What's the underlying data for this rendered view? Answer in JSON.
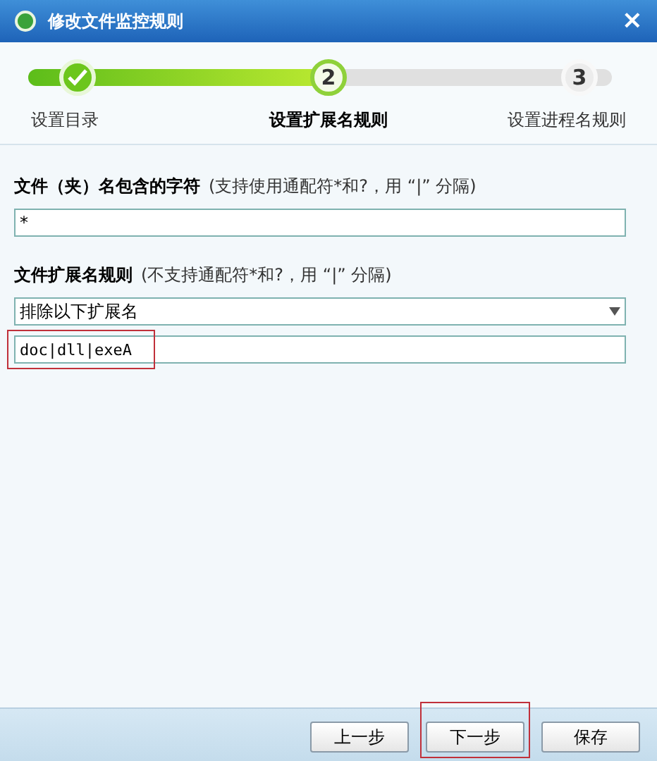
{
  "window": {
    "title": "修改文件监控规则",
    "close": "×"
  },
  "progress": {
    "level": 0.5
  },
  "steps": [
    {
      "label": "设置目录",
      "kind": "done"
    },
    {
      "number": "2",
      "label": "设置扩展名规则",
      "kind": "current"
    },
    {
      "number": "3",
      "label": "设置进程名规则",
      "kind": "pending"
    }
  ],
  "name_filter": {
    "label": "文件（夹）名包含的字符",
    "hint": "(支持使用通配符*和?，用 “|” 分隔)",
    "value": "*"
  },
  "ext_rule": {
    "label": "文件扩展名规则",
    "hint": "(不支持通配符*和?，用 “|” 分隔)",
    "mode": "排除以下扩展名",
    "value": "doc|dll|exeA",
    "highlighted": true
  },
  "buttons": [
    {
      "label": "上一步",
      "highlighted": false
    },
    {
      "label": "下一步",
      "highlighted": true
    },
    {
      "label": "保存",
      "highlighted": false
    }
  ]
}
